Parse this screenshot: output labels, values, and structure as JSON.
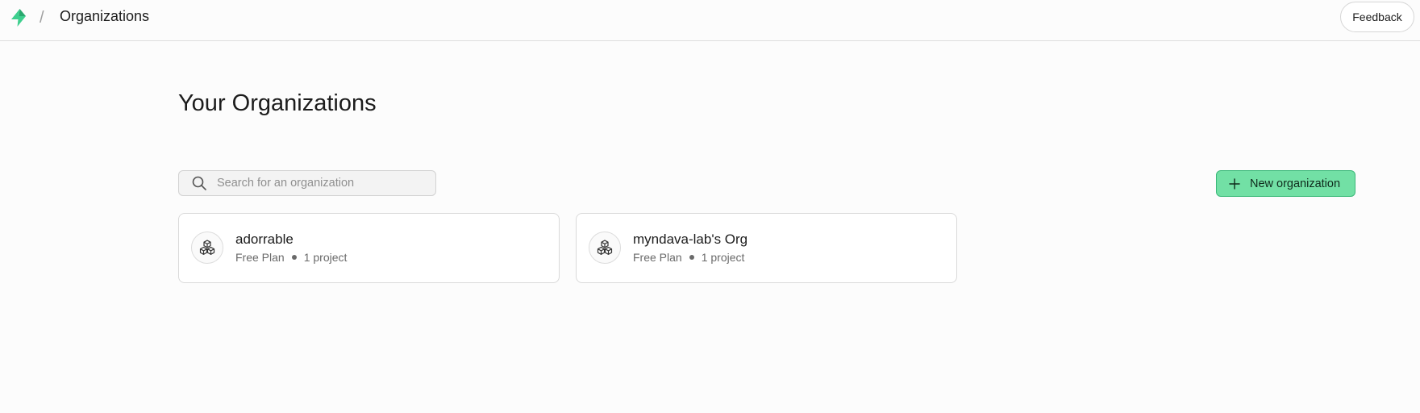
{
  "header": {
    "logo_icon": "supabase-bolt-icon",
    "separator": "/",
    "title": "Organizations",
    "feedback_label": "Feedback"
  },
  "main": {
    "title": "Your Organizations",
    "search": {
      "placeholder": "Search for an organization",
      "value": "",
      "icon": "search-icon"
    },
    "new_org_button": {
      "label": "New organization",
      "icon": "plus-icon"
    },
    "organizations": [
      {
        "name": "adorrable",
        "plan": "Free Plan",
        "projects": "1 project",
        "icon": "cubes-icon"
      },
      {
        "name": "myndava-lab's Org",
        "plan": "Free Plan",
        "projects": "1 project",
        "icon": "cubes-icon"
      }
    ]
  },
  "colors": {
    "brand": "#3ecf8e",
    "button_bg": "#72e0a5",
    "button_border": "#3cb97a",
    "page_bg": "#fcfcfc"
  }
}
